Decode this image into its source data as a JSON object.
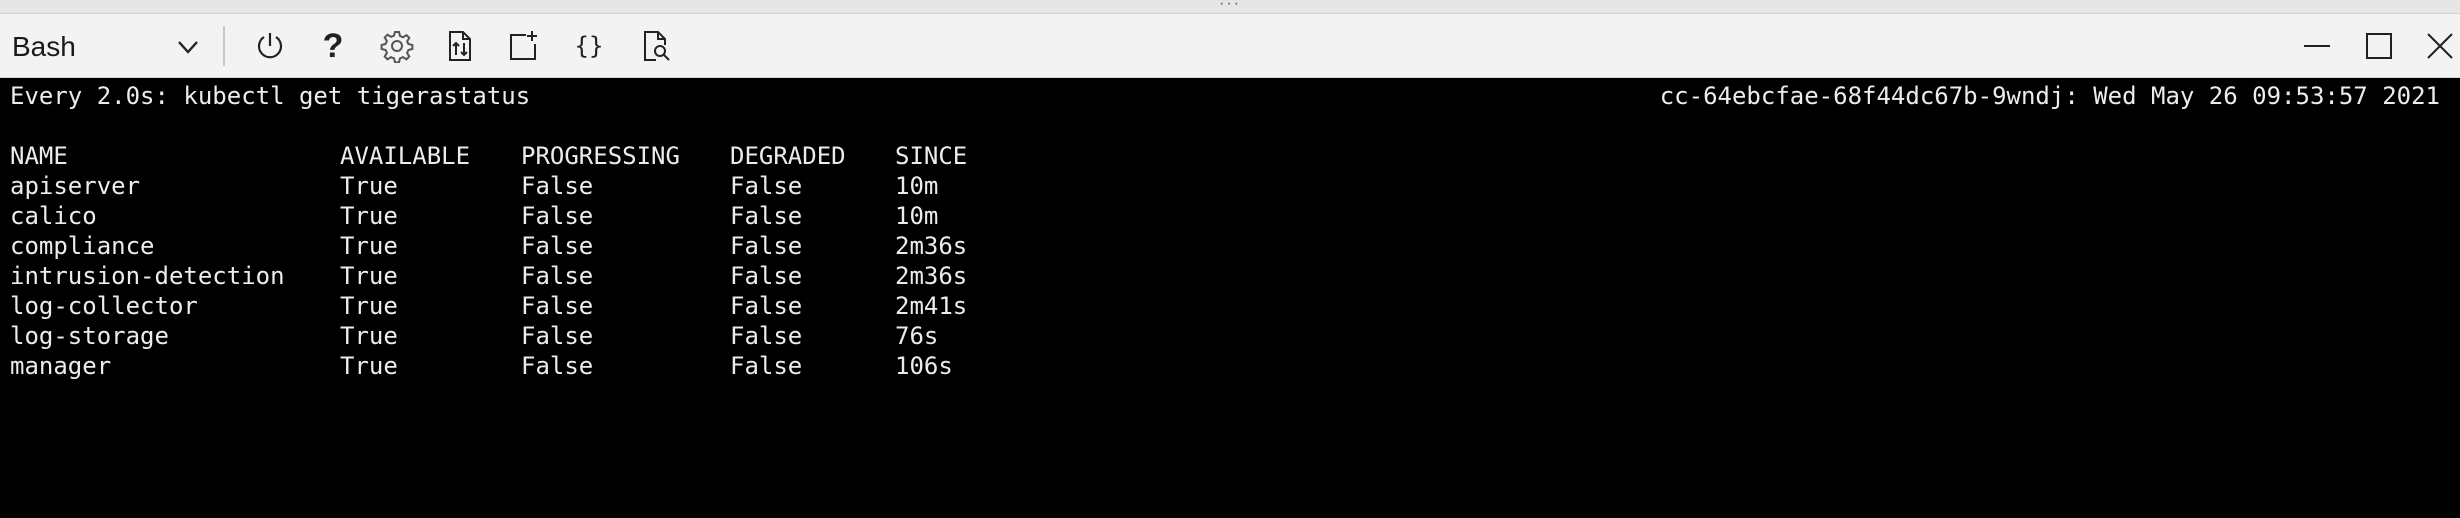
{
  "window": {
    "grab_handle": "···"
  },
  "toolbar": {
    "shell_selector": "Bash",
    "icons": [
      "power-icon",
      "help-icon",
      "gear-icon",
      "upload-download-icon",
      "new-session-icon",
      "braces-icon",
      "web-preview-icon"
    ],
    "help_glyph": "?",
    "braces_glyph": "{}"
  },
  "terminal": {
    "watch_command": "Every 2.0s: kubectl get tigerastatus",
    "watch_host_time": "cc-64ebcfae-68f44dc67b-9wndj: Wed May 26 09:53:57 2021",
    "table": {
      "headers": [
        "NAME",
        "AVAILABLE",
        "PROGRESSING",
        "DEGRADED",
        "SINCE"
      ],
      "rows": [
        [
          "apiserver",
          "True",
          "False",
          "False",
          "10m"
        ],
        [
          "calico",
          "True",
          "False",
          "False",
          "10m"
        ],
        [
          "compliance",
          "True",
          "False",
          "False",
          "2m36s"
        ],
        [
          "intrusion-detection",
          "True",
          "False",
          "False",
          "2m36s"
        ],
        [
          "log-collector",
          "True",
          "False",
          "False",
          "2m41s"
        ],
        [
          "log-storage",
          "True",
          "False",
          "False",
          "76s"
        ],
        [
          "manager",
          "True",
          "False",
          "False",
          "106s"
        ]
      ]
    }
  },
  "colors": {
    "terminal_bg": "#000000",
    "terminal_fg": "#ececec",
    "toolbar_bg": "#f3f3f3"
  }
}
